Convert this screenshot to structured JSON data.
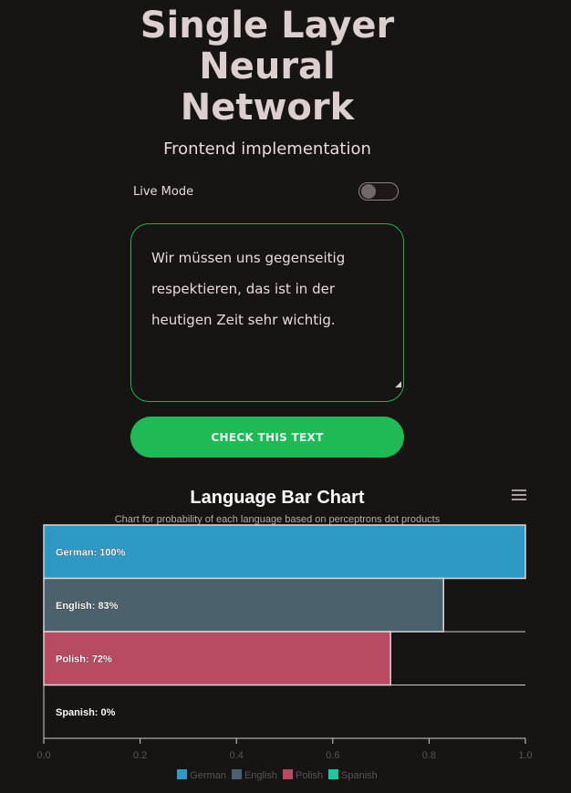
{
  "header": {
    "title_lines": [
      "Single Layer",
      "Neural",
      "Network"
    ],
    "subtitle": "Frontend implementation"
  },
  "live_mode": {
    "label": "Live Mode",
    "enabled": false
  },
  "input": {
    "value": "Wir müssen uns gegenseitig respektieren, das ist in der heutigen Zeit sehr wichtig.",
    "lines": [
      "Wir müssen uns gegenseitig",
      "respektieren, das ist in der",
      "heutigen Zeit sehr wichtig."
    ]
  },
  "check_button_label": "Check this text",
  "chart_data": {
    "type": "bar",
    "orientation": "horizontal",
    "title": "Language Bar Chart",
    "subtitle": "Chart for probability of each language based on perceptrons dot products",
    "categories": [
      "German",
      "English",
      "Polish",
      "Spanish"
    ],
    "values": [
      1.0,
      0.83,
      0.72,
      0.0
    ],
    "data_labels": [
      "German: 100%",
      "English: 83%",
      "Polish: 72%",
      "Spanish: 0%"
    ],
    "colors": [
      "#2e99c5",
      "#4b616b",
      "#b84b61",
      "#1fc79e"
    ],
    "xlim": [
      0,
      1
    ],
    "x_ticks": [
      "0.0",
      "0.2",
      "0.4",
      "0.6",
      "0.8",
      "1.0"
    ],
    "legend": {
      "position": "bottom",
      "labels": [
        "German",
        "English",
        "Polish",
        "Spanish"
      ]
    }
  }
}
